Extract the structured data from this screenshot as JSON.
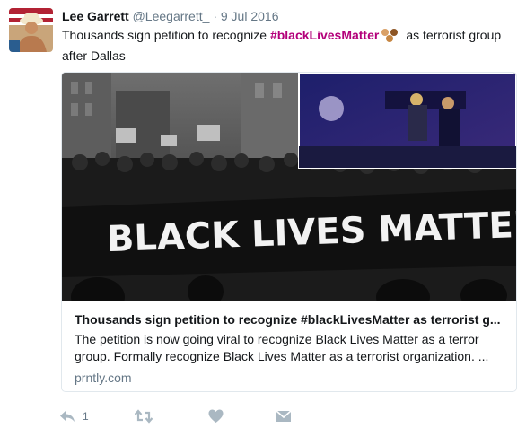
{
  "tweet": {
    "author_name": "Lee Garrett",
    "author_handle": "@Leegarrett_",
    "separator": "·",
    "date": "9 Jul 2016",
    "text_before": "Thousands sign petition to recognize ",
    "hashtag": "#blackLivesMatter",
    "text_after": "as terrorist group after Dallas",
    "emoji_icon": "three-skin-tone-dots-emoji"
  },
  "card": {
    "image_banner_text": "BLACK LIVES MATTER",
    "title": "Thousands sign petition to recognize #blackLivesMatter as terrorist g...",
    "description": "The petition is now going viral to recognize Black Lives Matter as a terror group. Formally recognize Black Lives Matter as a terrorist organization. ...",
    "domain": "prntly.com"
  },
  "actions": {
    "reply_icon": "reply-icon",
    "reply_count": "1",
    "retweet_icon": "retweet-icon",
    "like_icon": "heart-icon",
    "dm_icon": "envelope-icon"
  },
  "colors": {
    "hashtag": "#b3007a",
    "muted": "#657786",
    "icon": "#aab8c2",
    "border": "#e1e8ed"
  }
}
